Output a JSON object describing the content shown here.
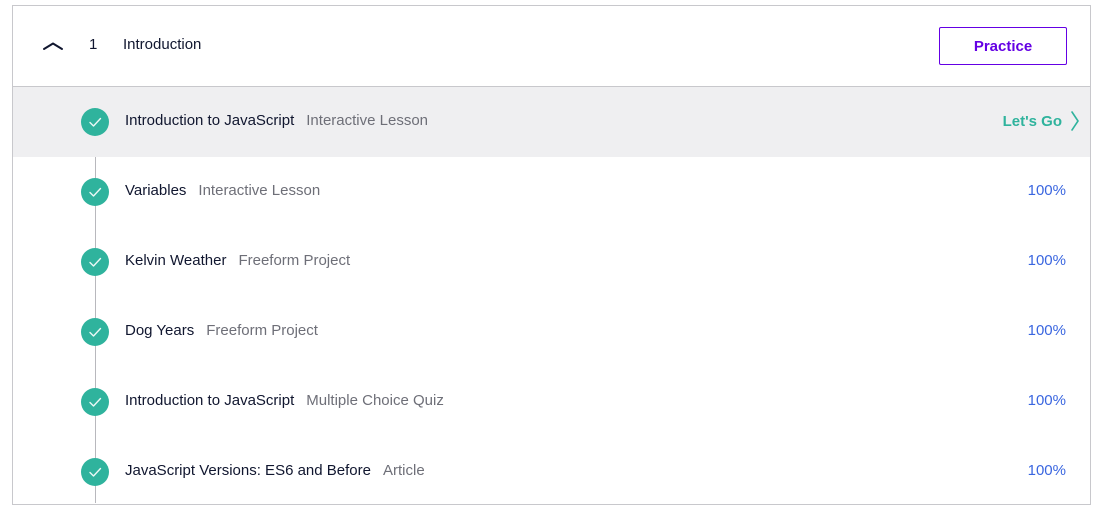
{
  "section": {
    "number": "1",
    "title": "Introduction",
    "practice_label": "Practice",
    "expanded": true
  },
  "lessons": [
    {
      "title": "Introduction to JavaScript",
      "type": "Interactive Lesson",
      "status": "Let's Go",
      "active": true,
      "completed": true
    },
    {
      "title": "Variables",
      "type": "Interactive Lesson",
      "status": "100%",
      "active": false,
      "completed": true
    },
    {
      "title": "Kelvin Weather",
      "type": "Freeform Project",
      "status": "100%",
      "active": false,
      "completed": true
    },
    {
      "title": "Dog Years",
      "type": "Freeform Project",
      "status": "100%",
      "active": false,
      "completed": true
    },
    {
      "title": "Introduction to JavaScript",
      "type": "Multiple Choice Quiz",
      "status": "100%",
      "active": false,
      "completed": true
    },
    {
      "title": "JavaScript Versions: ES6 and Before",
      "type": "Article",
      "status": "100%",
      "active": false,
      "completed": true
    }
  ],
  "icons": {
    "collapse": "chevron-up-icon",
    "complete": "check-icon",
    "go": "chevron-right-icon"
  },
  "colors": {
    "accent_purple": "#6400e4",
    "complete_green": "#2fb39d",
    "progress_blue": "#3a66e0",
    "active_row_bg": "#efeff1"
  }
}
